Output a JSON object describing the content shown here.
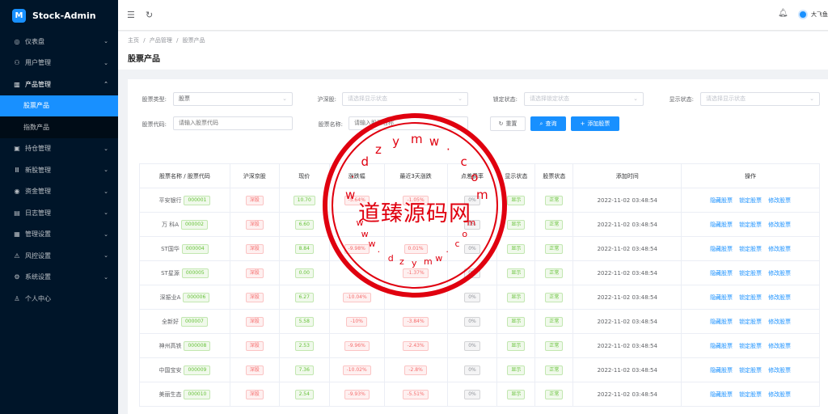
{
  "app": {
    "title": "Stock-Admin",
    "logo_text": "M"
  },
  "sidebar": {
    "items": [
      {
        "label": "仪表盘",
        "icon": "dashboard-icon",
        "glyph": "◎"
      },
      {
        "label": "用户管理",
        "icon": "users-icon",
        "glyph": "⚇"
      },
      {
        "label": "产品管理",
        "icon": "chart-icon",
        "glyph": "▥"
      },
      {
        "label": "持仓管理",
        "icon": "position-icon",
        "glyph": "▣"
      },
      {
        "label": "新股管理",
        "icon": "ipo-icon",
        "glyph": "Ⅲ"
      },
      {
        "label": "资金管理",
        "icon": "money-icon",
        "glyph": "◉"
      },
      {
        "label": "日志管理",
        "icon": "log-icon",
        "glyph": "▤"
      },
      {
        "label": "管理设置",
        "icon": "settings-grid-icon",
        "glyph": "▦"
      },
      {
        "label": "风控设置",
        "icon": "warning-icon",
        "glyph": "⚠"
      },
      {
        "label": "系统设置",
        "icon": "gear-icon",
        "glyph": "⚙"
      },
      {
        "label": "个人中心",
        "icon": "user-icon",
        "glyph": "♙"
      }
    ],
    "sub_items": [
      {
        "label": "股票产品"
      },
      {
        "label": "指数产品"
      }
    ]
  },
  "header": {
    "username": "大飞鱼"
  },
  "breadcrumb": [
    "主页",
    "产品管理",
    "股票产品"
  ],
  "breadcrumb_sep": "/",
  "page_title": "股票产品",
  "filters": {
    "type_label": "股票类型:",
    "type_value": "股票",
    "market_label": "沪深股:",
    "market_placeholder": "请选择显示状态",
    "lock_label": "锁定状态:",
    "lock_placeholder": "请选择锁定状态",
    "show_label": "显示状态:",
    "show_placeholder": "请选择显示状态",
    "code_label": "股票代码:",
    "code_placeholder": "请输入股票代码",
    "name_label": "股票名称:",
    "name_placeholder": "请输入股票名称",
    "reset": "重置",
    "search": "查询",
    "add": "添加股票"
  },
  "table": {
    "columns": [
      "股票名称 / 股票代码",
      "沪深京股",
      "现价",
      "涨跌幅",
      "最近3天涨跌",
      "点差费率",
      "显示状态",
      "股票状态",
      "添加时间",
      "操作"
    ],
    "actions": [
      "隐藏股票",
      "锁定股票",
      "修改股票"
    ],
    "rows": [
      {
        "name": "平安银行",
        "code": "000001",
        "market": "深股",
        "price": "10.70",
        "chg": "-5.64%",
        "chg3": "-1.05%",
        "spread": "0%",
        "show": "显示",
        "status": "正常",
        "time": "2022-11-02 03:48:54"
      },
      {
        "name": "万 科A",
        "code": "000002",
        "market": "深股",
        "price": "6.60",
        "chg": "",
        "chg3": "",
        "spread": "0%",
        "show": "显示",
        "status": "正常",
        "time": "2022-11-02 03:48:54"
      },
      {
        "name": "ST国华",
        "code": "000004",
        "market": "深股",
        "price": "8.84",
        "chg": "-9.98%",
        "chg3": "0.01%",
        "spread": "0%",
        "show": "显示",
        "status": "正常",
        "time": "2022-11-02 03:48:54"
      },
      {
        "name": "ST星源",
        "code": "000005",
        "market": "深股",
        "price": "0.00",
        "chg": "",
        "chg3": "-1.37%",
        "spread": "0%",
        "show": "显示",
        "status": "正常",
        "time": "2022-11-02 03:48:54"
      },
      {
        "name": "深振业A",
        "code": "000006",
        "market": "深股",
        "price": "6.27",
        "chg": "-10.04%",
        "chg3": "",
        "spread": "0%",
        "show": "显示",
        "status": "正常",
        "time": "2022-11-02 03:48:54"
      },
      {
        "name": "全新好",
        "code": "000007",
        "market": "深股",
        "price": "5.58",
        "chg": "-10%",
        "chg3": "-3.84%",
        "spread": "0%",
        "show": "显示",
        "status": "正常",
        "time": "2022-11-02 03:48:54"
      },
      {
        "name": "神州高铁",
        "code": "000008",
        "market": "深股",
        "price": "2.53",
        "chg": "-9.96%",
        "chg3": "-2.43%",
        "spread": "0%",
        "show": "显示",
        "status": "正常",
        "time": "2022-11-02 03:48:54"
      },
      {
        "name": "中国宝安",
        "code": "000009",
        "market": "深股",
        "price": "7.36",
        "chg": "-10.02%",
        "chg3": "-2.8%",
        "spread": "0%",
        "show": "显示",
        "status": "正常",
        "time": "2022-11-02 03:48:54"
      },
      {
        "name": "美丽生态",
        "code": "000010",
        "market": "深股",
        "price": "2.54",
        "chg": "-9.93%",
        "chg3": "-5.51%",
        "spread": "0%",
        "show": "显示",
        "status": "正常",
        "time": "2022-11-02 03:48:54"
      }
    ]
  },
  "watermark": {
    "text": "道臻源码网",
    "letters_top": [
      "w",
      "·",
      "d",
      "z",
      "y",
      "m",
      "w",
      "·",
      "c",
      "o",
      "m"
    ],
    "letters_bottom": [
      "w",
      "w",
      "w",
      "·",
      "d",
      "z",
      "y",
      "m",
      "w",
      "·",
      "c",
      "o",
      "m"
    ],
    "color": "#e0000f"
  },
  "colors": {
    "primary": "#1890ff",
    "sidebar_bg": "#001529"
  }
}
